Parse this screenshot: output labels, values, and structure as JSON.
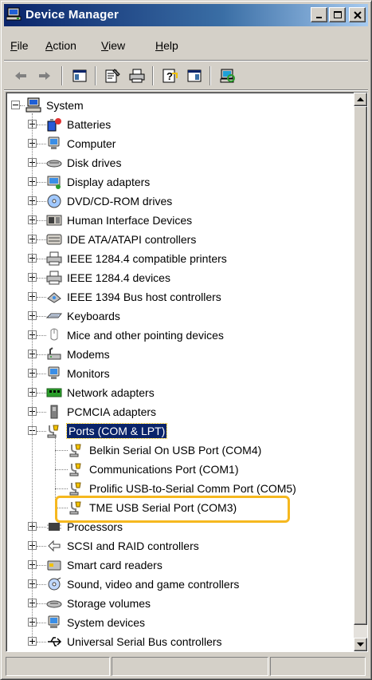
{
  "window": {
    "title": "Device Manager",
    "caption_buttons": [
      "minimize",
      "maximize",
      "close"
    ]
  },
  "menu": {
    "items": [
      {
        "label": "File",
        "accel": "F",
        "rest": "ile"
      },
      {
        "label": "Action",
        "accel": "A",
        "rest": "ction"
      },
      {
        "label": "View",
        "accel": "V",
        "rest": "iew"
      },
      {
        "label": "Help",
        "accel": "H",
        "rest": "elp"
      }
    ]
  },
  "toolbar": {
    "buttons": [
      "back-arrow-icon",
      "forward-arrow-icon",
      "show-hide-console-tree-icon",
      "properties-icon",
      "print-icon",
      "help-icon",
      "show-hide-action-pane-icon",
      "scan-hardware-icon"
    ]
  },
  "tree": {
    "root": {
      "label": "System",
      "icon": "computer-icon",
      "expanded": true
    },
    "categories": [
      {
        "label": "Batteries",
        "icon": "battery-icon"
      },
      {
        "label": "Computer",
        "icon": "monitor-icon"
      },
      {
        "label": "Disk drives",
        "icon": "disk-drive-icon"
      },
      {
        "label": "Display adapters",
        "icon": "display-adapter-icon"
      },
      {
        "label": "DVD/CD-ROM drives",
        "icon": "cdrom-icon"
      },
      {
        "label": "Human Interface Devices",
        "icon": "hid-icon"
      },
      {
        "label": "IDE ATA/ATAPI controllers",
        "icon": "ide-controller-icon"
      },
      {
        "label": "IEEE 1284.4 compatible printers",
        "icon": "printer-icon"
      },
      {
        "label": "IEEE 1284.4 devices",
        "icon": "printer-icon"
      },
      {
        "label": "IEEE 1394 Bus host controllers",
        "icon": "firewire-icon"
      },
      {
        "label": "Keyboards",
        "icon": "keyboard-icon"
      },
      {
        "label": "Mice and other pointing devices",
        "icon": "mouse-icon"
      },
      {
        "label": "Modems",
        "icon": "modem-icon"
      },
      {
        "label": "Monitors",
        "icon": "monitor-icon"
      },
      {
        "label": "Network adapters",
        "icon": "network-adapter-icon"
      },
      {
        "label": "PCMCIA adapters",
        "icon": "pcmcia-icon"
      },
      {
        "label": "Ports (COM & LPT)",
        "icon": "port-icon",
        "expanded": true,
        "selected": true,
        "children": [
          {
            "label": "Belkin Serial On USB Port (COM4)",
            "icon": "port-icon"
          },
          {
            "label": "Communications Port (COM1)",
            "icon": "port-icon"
          },
          {
            "label": "Prolific USB-to-Serial Comm Port (COM5)",
            "icon": "port-icon"
          },
          {
            "label": "TME USB Serial Port (COM3)",
            "icon": "port-icon",
            "highlighted": true
          }
        ]
      },
      {
        "label": "Processors",
        "icon": "processor-icon"
      },
      {
        "label": "SCSI and RAID controllers",
        "icon": "scsi-icon"
      },
      {
        "label": "Smart card readers",
        "icon": "smart-card-icon"
      },
      {
        "label": "Sound, video and game controllers",
        "icon": "sound-icon"
      },
      {
        "label": "Storage volumes",
        "icon": "storage-volume-icon"
      },
      {
        "label": "System devices",
        "icon": "system-device-icon"
      },
      {
        "label": "Universal Serial Bus controllers",
        "icon": "usb-icon"
      }
    ]
  },
  "colors": {
    "title_gradient_start": "#0a246a",
    "title_gradient_end": "#a6caf0",
    "selection": "#0a246a",
    "highlight_box": "#f6b81f",
    "face": "#d4d0c8"
  },
  "statusbar": {
    "panes": [
      "",
      "",
      ""
    ]
  }
}
